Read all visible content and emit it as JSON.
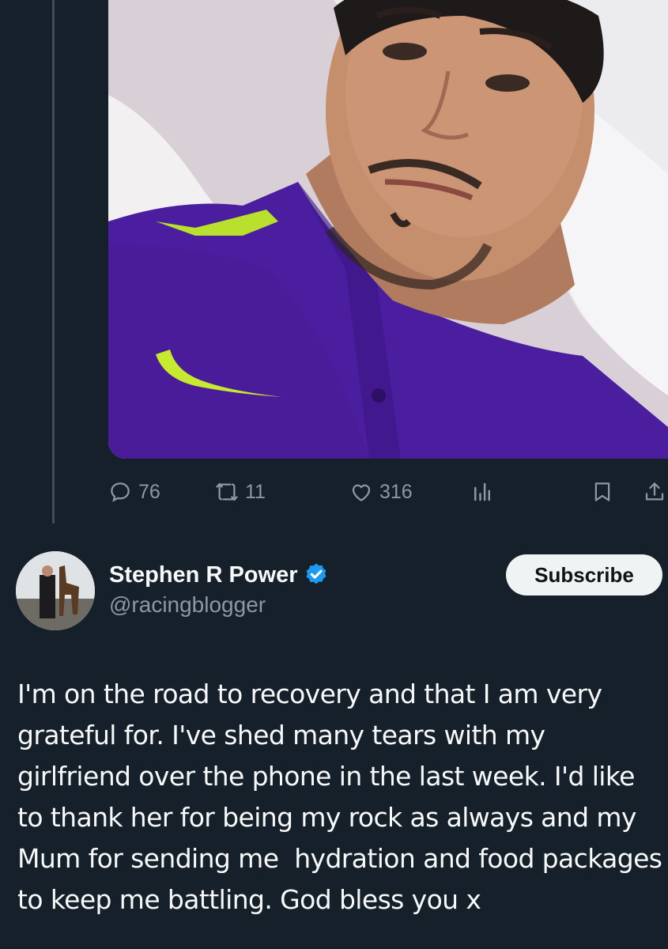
{
  "post": {
    "actions": {
      "reply_count": "76",
      "retweet_count": "11",
      "like_count": "316"
    }
  },
  "author": {
    "display_name": "Stephen R Power",
    "handle": "@racingblogger",
    "verified": true,
    "subscribe_label": "Subscribe"
  },
  "tweet": {
    "text": "I'm on the road to recovery and that I am very grateful for. I've shed many tears with my girlfriend over the phone in the last week. I'd like to thank her for being my rock as always and my Mum for sending me  hydration and food packages to keep me battling. God bless you x"
  },
  "icons": {
    "reply": "reply-icon",
    "retweet": "retweet-icon",
    "like": "heart-icon",
    "views": "views-icon",
    "bookmark": "bookmark-icon",
    "share": "share-icon",
    "verified": "verified-badge-icon"
  },
  "colors": {
    "background": "#15202b",
    "text_primary": "#f7f9f9",
    "text_secondary": "#8b98a5",
    "verified_blue": "#1d9bf0",
    "subscribe_bg": "#eff3f4"
  }
}
